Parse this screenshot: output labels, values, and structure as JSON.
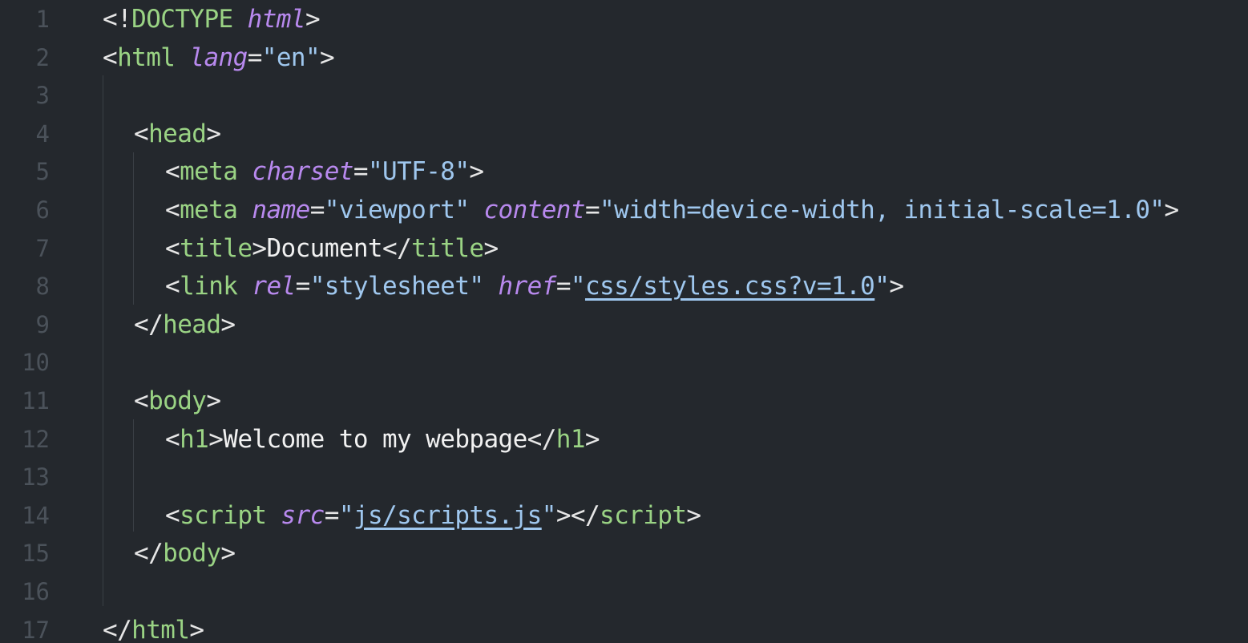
{
  "editor": {
    "lines": [
      {
        "n": "1",
        "indent": 0,
        "tokens": [
          [
            "p",
            "<!"
          ],
          [
            "t",
            "DOCTYPE"
          ],
          [
            "p",
            " "
          ],
          [
            "a",
            "html"
          ],
          [
            "p",
            ">"
          ]
        ]
      },
      {
        "n": "2",
        "indent": 0,
        "tokens": [
          [
            "p",
            "<"
          ],
          [
            "t",
            "html"
          ],
          [
            "p",
            " "
          ],
          [
            "a",
            "lang"
          ],
          [
            "p",
            "="
          ],
          [
            "s",
            "\"en\""
          ],
          [
            "p",
            ">"
          ]
        ]
      },
      {
        "n": "3",
        "indent": 0,
        "tokens": []
      },
      {
        "n": "4",
        "indent": 1,
        "tokens": [
          [
            "p",
            "<"
          ],
          [
            "t",
            "head"
          ],
          [
            "p",
            ">"
          ]
        ]
      },
      {
        "n": "5",
        "indent": 2,
        "tokens": [
          [
            "p",
            "<"
          ],
          [
            "t",
            "meta"
          ],
          [
            "p",
            " "
          ],
          [
            "a",
            "charset"
          ],
          [
            "p",
            "="
          ],
          [
            "s",
            "\"UTF-8\""
          ],
          [
            "p",
            ">"
          ]
        ]
      },
      {
        "n": "6",
        "indent": 2,
        "tokens": [
          [
            "p",
            "<"
          ],
          [
            "t",
            "meta"
          ],
          [
            "p",
            " "
          ],
          [
            "a",
            "name"
          ],
          [
            "p",
            "="
          ],
          [
            "s",
            "\"viewport\""
          ],
          [
            "p",
            " "
          ],
          [
            "a",
            "content"
          ],
          [
            "p",
            "="
          ],
          [
            "s",
            "\"width=device-width, initial-scale=1.0\""
          ],
          [
            "p",
            ">"
          ]
        ]
      },
      {
        "n": "7",
        "indent": 2,
        "tokens": [
          [
            "p",
            "<"
          ],
          [
            "t",
            "title"
          ],
          [
            "p",
            ">"
          ],
          [
            "x",
            "Document"
          ],
          [
            "p",
            "</"
          ],
          [
            "t",
            "title"
          ],
          [
            "p",
            ">"
          ]
        ]
      },
      {
        "n": "8",
        "indent": 2,
        "tokens": [
          [
            "p",
            "<"
          ],
          [
            "t",
            "link"
          ],
          [
            "p",
            " "
          ],
          [
            "a",
            "rel"
          ],
          [
            "p",
            "="
          ],
          [
            "s",
            "\"stylesheet\""
          ],
          [
            "p",
            " "
          ],
          [
            "a",
            "href"
          ],
          [
            "p",
            "="
          ],
          [
            "s",
            "\""
          ],
          [
            "u",
            "css/styles.css?v=1.0"
          ],
          [
            "s",
            "\""
          ],
          [
            "p",
            ">"
          ]
        ]
      },
      {
        "n": "9",
        "indent": 1,
        "tokens": [
          [
            "p",
            "</"
          ],
          [
            "t",
            "head"
          ],
          [
            "p",
            ">"
          ]
        ]
      },
      {
        "n": "10",
        "indent": 0,
        "tokens": []
      },
      {
        "n": "11",
        "indent": 1,
        "tokens": [
          [
            "p",
            "<"
          ],
          [
            "t",
            "body"
          ],
          [
            "p",
            ">"
          ]
        ]
      },
      {
        "n": "12",
        "indent": 2,
        "tokens": [
          [
            "p",
            "<"
          ],
          [
            "t",
            "h1"
          ],
          [
            "p",
            ">"
          ],
          [
            "x",
            "Welcome to my webpage"
          ],
          [
            "p",
            "</"
          ],
          [
            "t",
            "h1"
          ],
          [
            "p",
            ">"
          ]
        ]
      },
      {
        "n": "13",
        "indent": 0,
        "tokens": []
      },
      {
        "n": "14",
        "indent": 2,
        "tokens": [
          [
            "p",
            "<"
          ],
          [
            "t",
            "script"
          ],
          [
            "p",
            " "
          ],
          [
            "a",
            "src"
          ],
          [
            "p",
            "="
          ],
          [
            "s",
            "\""
          ],
          [
            "u",
            "js/scripts.js"
          ],
          [
            "s",
            "\""
          ],
          [
            "p",
            "></"
          ],
          [
            "t",
            "script"
          ],
          [
            "p",
            ">"
          ]
        ]
      },
      {
        "n": "15",
        "indent": 1,
        "tokens": [
          [
            "p",
            "</"
          ],
          [
            "t",
            "body"
          ],
          [
            "p",
            ">"
          ]
        ]
      },
      {
        "n": "16",
        "indent": 0,
        "tokens": []
      },
      {
        "n": "17",
        "indent": 0,
        "tokens": [
          [
            "p",
            "</"
          ],
          [
            "t",
            "html"
          ],
          [
            "p",
            ">"
          ]
        ]
      }
    ]
  },
  "colors": {
    "background": "#24282d",
    "tag": "#9ad384",
    "attribute": "#b889ee",
    "string": "#9fc7ee",
    "line_number": "#4b525a"
  }
}
